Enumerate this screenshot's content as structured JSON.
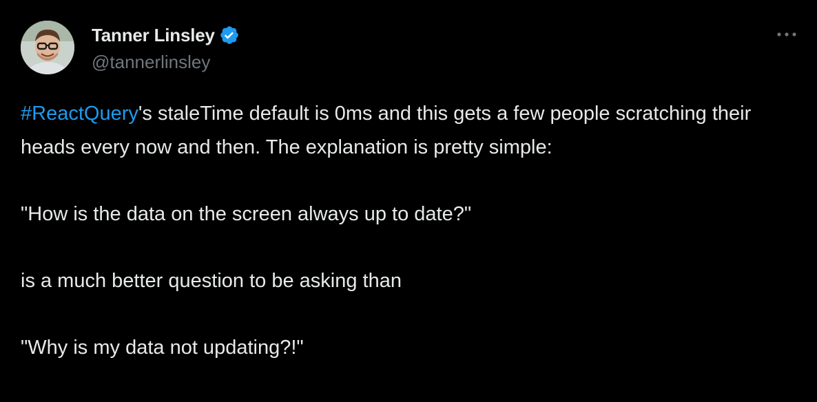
{
  "author": {
    "display_name": "Tanner Linsley",
    "handle": "@tannerlinsley",
    "verified": true,
    "avatar_icon": "user-avatar"
  },
  "tweet": {
    "hashtag": "#ReactQuery",
    "line1_rest": "'s staleTime default is 0ms and this gets a few people scratching their heads every now and then. The explanation is pretty simple:",
    "quote1": "\"How is the data on the screen always up to date?\"",
    "middle": "is a much better question to be asking than",
    "quote2": "\"Why is my data not updating?!\""
  },
  "colors": {
    "background": "#000000",
    "text": "#e7e9ea",
    "secondary_text": "#71767b",
    "accent": "#1d9bf0"
  },
  "icons": {
    "more": "more-options-icon",
    "verified": "verified-badge-icon"
  }
}
